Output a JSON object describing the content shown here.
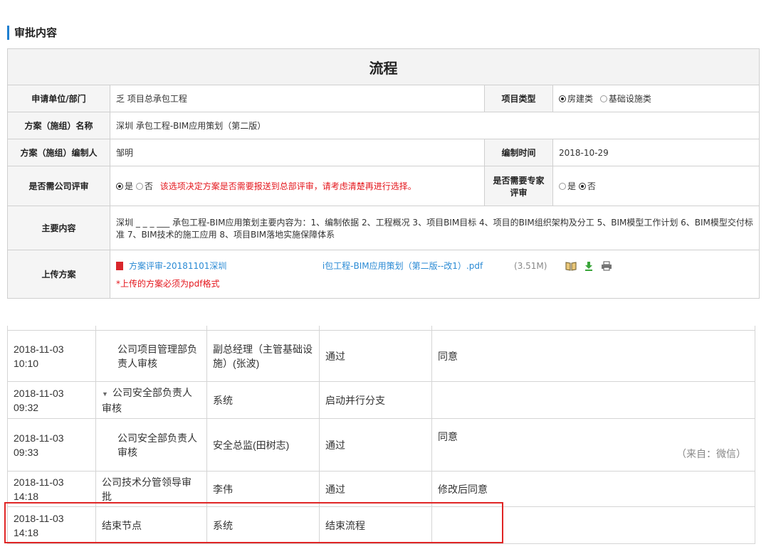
{
  "section": {
    "title": "审批内容"
  },
  "form": {
    "title": "​流程",
    "applicant_label": "申请单位/部门",
    "applicant_value": "乏                 项目总承包工程",
    "project_type_label": "项目类型",
    "project_type_options": [
      "房建类",
      "基础设施类"
    ],
    "project_type_selected": "房建类",
    "plan_name_label": "方案（施组）名称",
    "plan_name_value": "深圳                承包工程-BIM应用策划（第二版）",
    "editor_label": "方案（施组）编制人",
    "editor_value": "邹明",
    "edit_time_label": "编制时间",
    "edit_time_value": "2018-10-29",
    "company_review_label": "是否需公司评审",
    "yes_label": "是",
    "no_label": "否",
    "company_review_selected": "是",
    "company_review_note": "该选项决定方案是否需要报送到总部评审，请考虑清楚再进行选择。",
    "expert_review_label": "是否需要专家评审",
    "expert_review_selected": "否",
    "main_content_label": "主要内容",
    "main_content_value": "深圳 _ _ _ ___ 承包工程-BIM应用策划主要内容为：1、编制依据 2、工程概况 3、项目BIM目标 4、项目的BIM组织架构及分工 5、BIM模型工作计划 6、BIM模型交付标准 7、BIM技术的施工应用 8、项目BIM落地实施保障体系",
    "upload_label": "上传方案",
    "file_name_a": "方案评审-20181101深圳",
    "file_name_b": "　　　　　　　　　　　 i包工程-BIM应用策划（第二版--改1）.pdf",
    "file_size": "(3.51M)",
    "upload_note": "*上传的方案必须为pdf格式"
  },
  "log": {
    "rows": [
      {
        "time": "2018-11-03 10:10",
        "node": "公司项目管理部负责人审核",
        "handler": "副总经理（主管基础设施）(张波)",
        "action": "通过",
        "comment": "同意",
        "source": ""
      },
      {
        "time": "2018-11-03 09:32",
        "node": "公司安全部负责人审核",
        "handler": "系统",
        "action": "启动并行分支",
        "comment": "",
        "source": ""
      },
      {
        "time": "2018-11-03 09:33",
        "node": "公司安全部负责人审核",
        "handler": "安全总监(田树志)",
        "action": "通过",
        "comment": "同意",
        "source": "（来自：微信）"
      },
      {
        "time": "2018-11-03 14:18",
        "node": "公司技术分管领导审批",
        "handler": "李伟",
        "action": "通过",
        "comment": "修改后同意",
        "source": ""
      },
      {
        "time": "2018-11-03 14:18",
        "node": "结束节点",
        "handler": "系统",
        "action": "结束流程",
        "comment": "",
        "source": ""
      }
    ]
  },
  "colors": {
    "accent": "#1e7fd0",
    "warning": "#e4161c",
    "link": "#2a8ad4",
    "highlight": "#e02525"
  }
}
